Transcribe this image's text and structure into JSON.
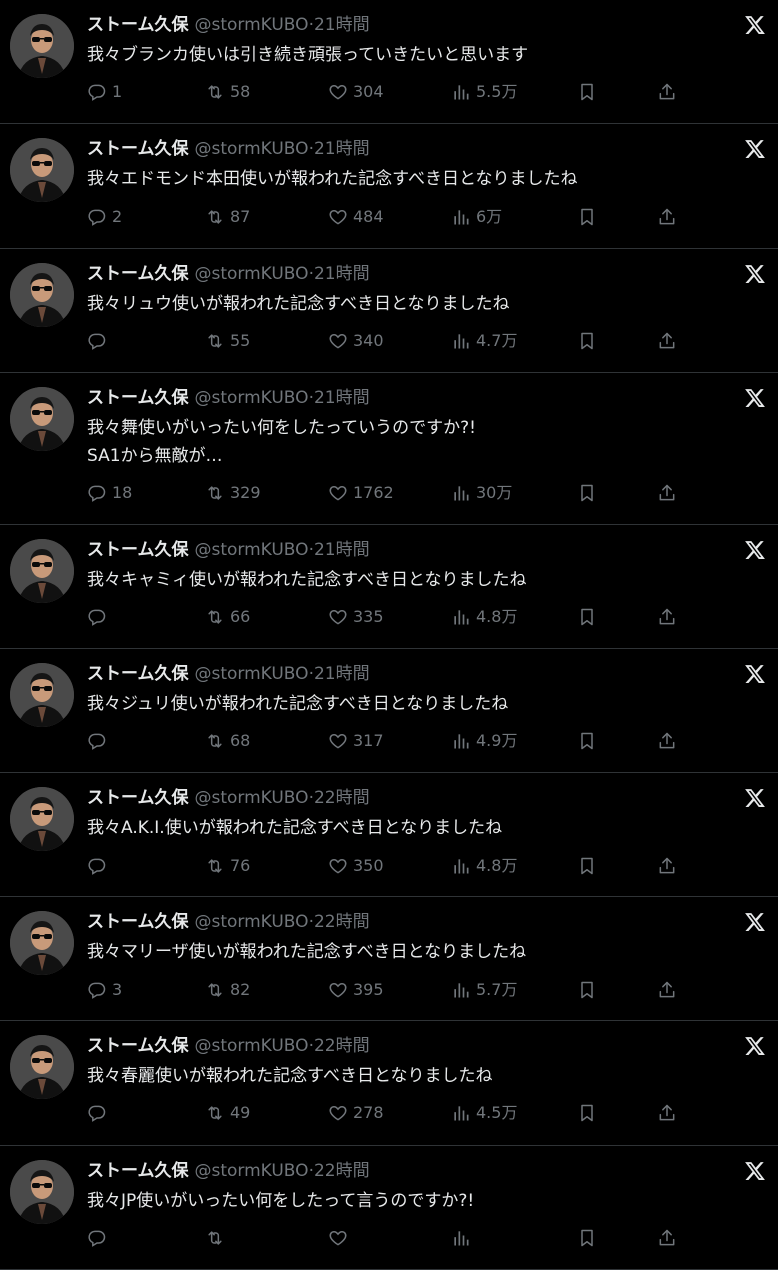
{
  "tweets": [
    {
      "name": "ストーム久保",
      "handle": "@stormKUBO",
      "dot": "·",
      "time": "21時間",
      "text": "我々ブランカ使いは引き続き頑張っていきたいと思います",
      "replies": "1",
      "retweets": "58",
      "likes": "304",
      "views": "5.5万"
    },
    {
      "name": "ストーム久保",
      "handle": "@stormKUBO",
      "dot": "·",
      "time": "21時間",
      "text": "我々エドモンド本田使いが報われた記念すべき日となりましたね",
      "replies": "2",
      "retweets": "87",
      "likes": "484",
      "views": "6万"
    },
    {
      "name": "ストーム久保",
      "handle": "@stormKUBO",
      "dot": "·",
      "time": "21時間",
      "text": "我々リュウ使いが報われた記念すべき日となりましたね",
      "replies": "",
      "retweets": "55",
      "likes": "340",
      "views": "4.7万"
    },
    {
      "name": "ストーム久保",
      "handle": "@stormKUBO",
      "dot": "·",
      "time": "21時間",
      "text": "我々舞使いがいったい何をしたっていうのですか?!\nSA1から無敵が…",
      "replies": "18",
      "retweets": "329",
      "likes": "1762",
      "views": "30万"
    },
    {
      "name": "ストーム久保",
      "handle": "@stormKUBO",
      "dot": "·",
      "time": "21時間",
      "text": "我々キャミィ使いが報われた記念すべき日となりましたね",
      "replies": "",
      "retweets": "66",
      "likes": "335",
      "views": "4.8万"
    },
    {
      "name": "ストーム久保",
      "handle": "@stormKUBO",
      "dot": "·",
      "time": "21時間",
      "text": "我々ジュリ使いが報われた記念すべき日となりましたね",
      "replies": "",
      "retweets": "68",
      "likes": "317",
      "views": "4.9万"
    },
    {
      "name": "ストーム久保",
      "handle": "@stormKUBO",
      "dot": "·",
      "time": "22時間",
      "text": "我々A.K.I.使いが報われた記念すべき日となりましたね",
      "replies": "",
      "retweets": "76",
      "likes": "350",
      "views": "4.8万"
    },
    {
      "name": "ストーム久保",
      "handle": "@stormKUBO",
      "dot": "·",
      "time": "22時間",
      "text": "我々マリーザ使いが報われた記念すべき日となりましたね",
      "replies": "3",
      "retweets": "82",
      "likes": "395",
      "views": "5.7万"
    },
    {
      "name": "ストーム久保",
      "handle": "@stormKUBO",
      "dot": "·",
      "time": "22時間",
      "text": "我々春麗使いが報われた記念すべき日となりましたね",
      "replies": "",
      "retweets": "49",
      "likes": "278",
      "views": "4.5万"
    },
    {
      "name": "ストーム久保",
      "handle": "@stormKUBO",
      "dot": "·",
      "time": "22時間",
      "text": "我々JP使いがいったい何をしたって言うのですか?!",
      "replies": "",
      "retweets": "",
      "likes": "",
      "views": ""
    }
  ],
  "icons": {
    "reply": "reply-icon",
    "retweet": "retweet-icon",
    "like": "heart-icon",
    "views": "views-chart-icon",
    "bookmark": "bookmark-icon",
    "share": "share-icon",
    "platform": "x-logo-icon",
    "avatar": "profile-avatar"
  },
  "colors": {
    "background": "#000000",
    "text": "#e7e9ea",
    "muted": "#71767b",
    "divider": "#2f3336"
  }
}
